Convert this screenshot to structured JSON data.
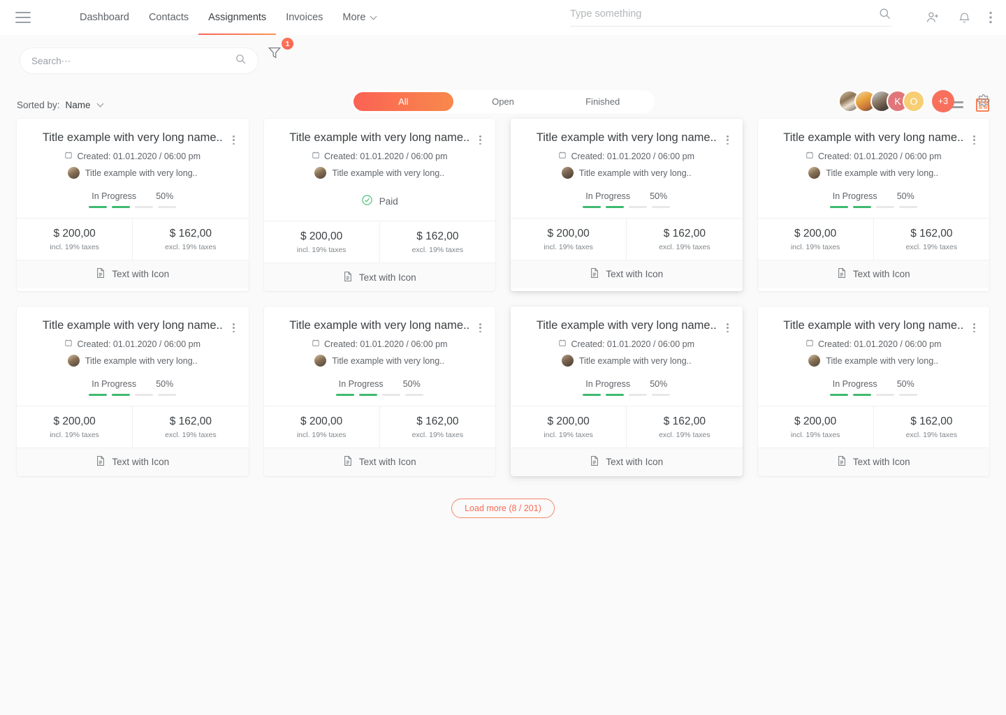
{
  "topnav": {
    "menu_icon": "hamburger-icon",
    "items": [
      {
        "label": "Dashboard",
        "active": false
      },
      {
        "label": "Contacts",
        "active": false
      },
      {
        "label": "Assignments",
        "active": true
      },
      {
        "label": "Invoices",
        "active": false
      },
      {
        "label": "More",
        "active": false,
        "has_chevron": true
      }
    ],
    "search": {
      "value": "",
      "placeholder": "Type something"
    },
    "icons": [
      "search-icon",
      "add-user-icon",
      "notifications-bell-icon",
      "more-vertical-icon"
    ]
  },
  "toolbar": {
    "search": {
      "value": "",
      "placeholder": "Search⋯"
    },
    "filter": {
      "icon": "filter-funnel-icon",
      "badge": "1"
    },
    "tabs": [
      {
        "label": "All",
        "active": true
      },
      {
        "label": "Open",
        "active": false
      },
      {
        "label": "Finished",
        "active": false
      }
    ],
    "avatars": [
      {
        "type": "photo",
        "label": ""
      },
      {
        "type": "photo",
        "label": ""
      },
      {
        "type": "photo",
        "label": ""
      },
      {
        "type": "initial",
        "label": "K",
        "color": "#e0767a"
      },
      {
        "type": "initial",
        "label": "O",
        "color": "#f7ce73"
      }
    ],
    "overflow_avatar": {
      "label": "+3",
      "color": "#f8705c"
    },
    "settings_icon": "gear-icon"
  },
  "sortbar": {
    "label": "Sorted by:",
    "value": "Name",
    "views": [
      {
        "name": "list-view",
        "active": false
      },
      {
        "name": "grid-view",
        "active": true
      }
    ]
  },
  "colors": {
    "accent_start": "#fb6254",
    "accent_end": "#f8894c",
    "progress_green": "#3fba6f",
    "page_bg": "#fafafa"
  },
  "cards": [
    {
      "title": "Title example with very long name..",
      "created": "Created: 01.01.2020 / 06:00 pm",
      "owner": "Title example with very long..",
      "status_type": "progress",
      "status_label": "In Progress",
      "percent": "50%",
      "segments_total": 4,
      "segments_filled": 2,
      "amount_incl": "$ 200,00",
      "amount_incl_note": "incl. 19% taxes",
      "amount_excl": "$ 162,00",
      "amount_excl_note": "excl. 19% taxes",
      "footer": "Text with Icon",
      "elevated": false
    },
    {
      "title": "Title example with very long name..",
      "created": "Created: 01.01.2020 / 06:00 pm",
      "owner": "Title example with very long..",
      "status_type": "paid",
      "status_label": "Paid",
      "percent": "",
      "segments_total": 4,
      "segments_filled": 0,
      "amount_incl": "$ 200,00",
      "amount_incl_note": "incl. 19% taxes",
      "amount_excl": "$ 162,00",
      "amount_excl_note": "excl. 19% taxes",
      "footer": "Text with Icon",
      "elevated": false
    },
    {
      "title": "Title example with very long name..",
      "created": "Created: 01.01.2020 / 06:00 pm",
      "owner": "Title example with very long..",
      "status_type": "progress",
      "status_label": "In Progress",
      "percent": "50%",
      "segments_total": 4,
      "segments_filled": 2,
      "amount_incl": "$ 200,00",
      "amount_incl_note": "incl. 19% taxes",
      "amount_excl": "$ 162,00",
      "amount_excl_note": "excl. 19% taxes",
      "footer": "Text with Icon",
      "elevated": true
    },
    {
      "title": "Title example with very long name..",
      "created": "Created: 01.01.2020 / 06:00 pm",
      "owner": "Title example with very long..",
      "status_type": "progress",
      "status_label": "In Progress",
      "percent": "50%",
      "segments_total": 4,
      "segments_filled": 2,
      "amount_incl": "$ 200,00",
      "amount_incl_note": "incl. 19% taxes",
      "amount_excl": "$ 162,00",
      "amount_excl_note": "excl. 19% taxes",
      "footer": "Text with Icon",
      "elevated": false
    },
    {
      "title": "Title example with very long name..",
      "created": "Created: 01.01.2020 / 06:00 pm",
      "owner": "Title example with very long..",
      "status_type": "progress",
      "status_label": "In Progress",
      "percent": "50%",
      "segments_total": 4,
      "segments_filled": 2,
      "amount_incl": "$ 200,00",
      "amount_incl_note": "incl. 19% taxes",
      "amount_excl": "$ 162,00",
      "amount_excl_note": "excl. 19% taxes",
      "footer": "Text with Icon",
      "elevated": false
    },
    {
      "title": "Title example with very long name..",
      "created": "Created: 01.01.2020 / 06:00 pm",
      "owner": "Title example with very long..",
      "status_type": "progress",
      "status_label": "In Progress",
      "percent": "50%",
      "segments_total": 4,
      "segments_filled": 2,
      "amount_incl": "$ 200,00",
      "amount_incl_note": "incl. 19% taxes",
      "amount_excl": "$ 162,00",
      "amount_excl_note": "excl. 19% taxes",
      "footer": "Text with Icon",
      "elevated": false
    },
    {
      "title": "Title example with very long name..",
      "created": "Created: 01.01.2020 / 06:00 pm",
      "owner": "Title example with very long..",
      "status_type": "progress",
      "status_label": "In Progress",
      "percent": "50%",
      "segments_total": 4,
      "segments_filled": 2,
      "amount_incl": "$ 200,00",
      "amount_incl_note": "incl. 19% taxes",
      "amount_excl": "$ 162,00",
      "amount_excl_note": "excl. 19% taxes",
      "footer": "Text with Icon",
      "elevated": true
    },
    {
      "title": "Title example with very long name..",
      "created": "Created: 01.01.2020 / 06:00 pm",
      "owner": "Title example with very long..",
      "status_type": "progress",
      "status_label": "In Progress",
      "percent": "50%",
      "segments_total": 4,
      "segments_filled": 2,
      "amount_incl": "$ 200,00",
      "amount_incl_note": "incl. 19% taxes",
      "amount_excl": "$ 162,00",
      "amount_excl_note": "excl. 19% taxes",
      "footer": "Text with Icon",
      "elevated": false
    }
  ],
  "load_more": {
    "label": "Load more (8 / 201)"
  }
}
